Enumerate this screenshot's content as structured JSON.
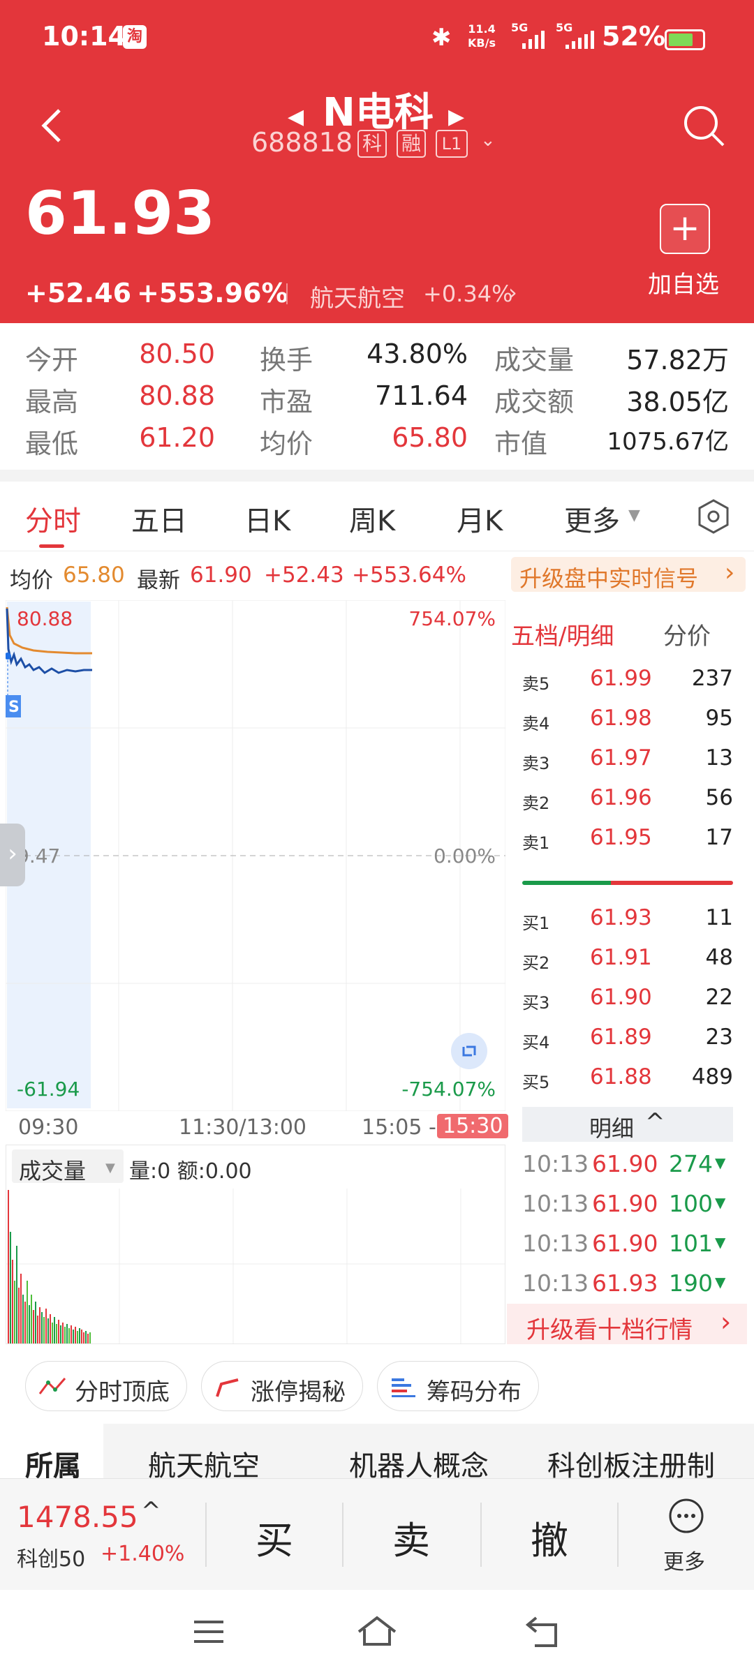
{
  "status_bar": {
    "time": "10:14",
    "app_badge": "淘",
    "net_speed": "11.4\nKB/s",
    "net_speed_top": "11.4",
    "net_speed_unit": "KB/s",
    "sim1": "5G",
    "sim2": "5G",
    "battery": "52%"
  },
  "header": {
    "stock_name": "N电科",
    "stock_code": "688818",
    "badges": [
      "科",
      "融",
      "L1"
    ],
    "price": "61.93",
    "change": "+52.46",
    "change_pct": "+553.96%",
    "sector_name": "航天航空",
    "sector_change": "+0.34%",
    "add_watch_label": "加自选",
    "colors": {
      "up": "#e3363b",
      "down": "#1a9a4a"
    }
  },
  "stats": [
    {
      "label": "今开",
      "value": "80.50"
    },
    {
      "label": "换手",
      "value": "43.80%"
    },
    {
      "label": "成交量",
      "value": "57.82万"
    },
    {
      "label": "最高",
      "value": "80.88"
    },
    {
      "label": "市盈",
      "value": "711.64"
    },
    {
      "label": "成交额",
      "value": "38.05亿"
    },
    {
      "label": "最低",
      "value": "61.20"
    },
    {
      "label": "均价",
      "value": "65.80"
    },
    {
      "label": "市值",
      "value": "1075.67亿"
    }
  ],
  "tabs": [
    "分时",
    "五日",
    "日K",
    "周K",
    "月K",
    "更多"
  ],
  "chart_info": {
    "avg_label": "均价",
    "avg_value": "65.80",
    "latest_label": "最新",
    "latest_value": "61.90",
    "latest_change": "+52.43",
    "latest_pct": "+553.64%",
    "upgrade_signal": "升级盘中实时信号",
    "y_top": "80.88",
    "y_mid": "9.47",
    "y_bottom": "-61.94",
    "pct_top": "754.07%",
    "pct_mid": "0.00%",
    "pct_bottom": "-754.07%",
    "time_start": "09:30",
    "time_mid": "11:30/13:00",
    "time_close": "15:05 -",
    "time_end": "15:30",
    "s_marker": "S"
  },
  "volume": {
    "selector": "成交量",
    "info": "量:0 额:0.00"
  },
  "order_book": {
    "header_left": "五档/明细",
    "header_right": "分价",
    "asks": [
      {
        "label": "卖5",
        "price": "61.99",
        "vol": "237"
      },
      {
        "label": "卖4",
        "price": "61.98",
        "vol": "95"
      },
      {
        "label": "卖3",
        "price": "61.97",
        "vol": "13"
      },
      {
        "label": "卖2",
        "price": "61.96",
        "vol": "56"
      },
      {
        "label": "卖1",
        "price": "61.95",
        "vol": "17"
      }
    ],
    "bids": [
      {
        "label": "买1",
        "price": "61.93",
        "vol": "11"
      },
      {
        "label": "买2",
        "price": "61.91",
        "vol": "48"
      },
      {
        "label": "买3",
        "price": "61.90",
        "vol": "22"
      },
      {
        "label": "买4",
        "price": "61.89",
        "vol": "23"
      },
      {
        "label": "买5",
        "price": "61.88",
        "vol": "489"
      }
    ],
    "detail_label": "明细",
    "ticks": [
      {
        "time": "10:13",
        "price": "61.90",
        "vol": "274"
      },
      {
        "time": "10:13",
        "price": "61.90",
        "vol": "100"
      },
      {
        "time": "10:13",
        "price": "61.90",
        "vol": "101"
      },
      {
        "time": "10:13",
        "price": "61.93",
        "vol": "190"
      }
    ],
    "upgrade_level10": "升级看十档行情"
  },
  "tools": [
    "分时顶底",
    "涨停揭秘",
    "筹码分布"
  ],
  "concept_tabs": [
    "所属",
    "航天航空",
    "机器人概念",
    "科创板注册制"
  ],
  "bottom": {
    "index_value": "1478.55",
    "index_name": "科创50",
    "index_change": "+1.40%",
    "buy": "买",
    "sell": "卖",
    "cancel": "撤",
    "more": "更多"
  }
}
